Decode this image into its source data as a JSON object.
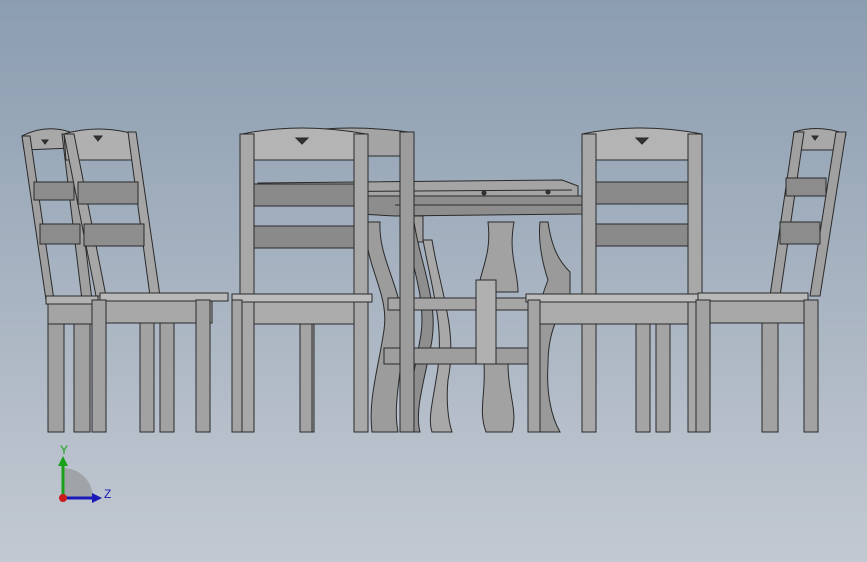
{
  "viewport": {
    "background_top": "#8b9db0",
    "background_bottom": "#c3c9d2",
    "model_stroke": "#2a2a2a",
    "model_fill": "#9a9a9a",
    "model_fill_light": "#b4b4b4",
    "model_fill_dark": "#7c7c7c"
  },
  "triad": {
    "y_label": "Y",
    "z_label": "Z",
    "y_color": "#1aa11a",
    "z_color": "#1a1ab8",
    "x_color": "#cc1a1a"
  }
}
